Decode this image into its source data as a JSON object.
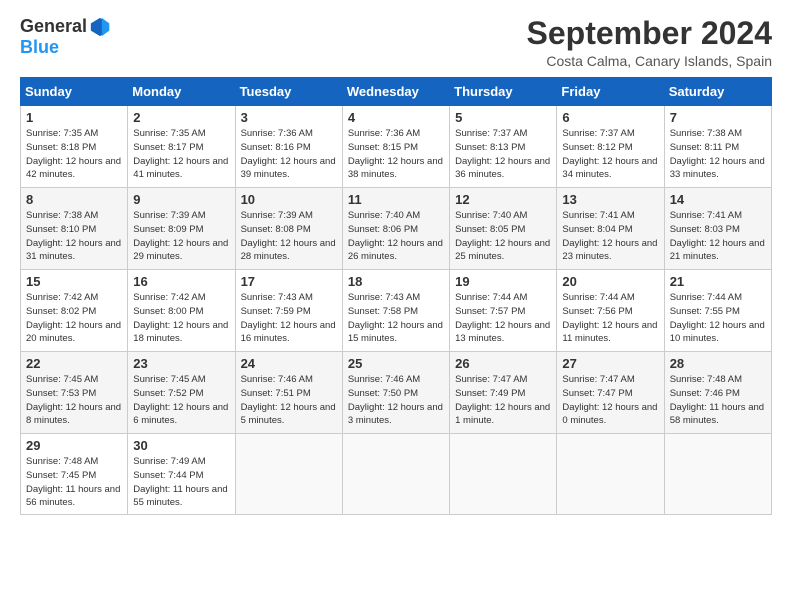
{
  "logo": {
    "line1": "General",
    "line2": "Blue"
  },
  "title": "September 2024",
  "location": "Costa Calma, Canary Islands, Spain",
  "headers": [
    "Sunday",
    "Monday",
    "Tuesday",
    "Wednesday",
    "Thursday",
    "Friday",
    "Saturday"
  ],
  "weeks": [
    [
      {
        "day": "1",
        "sunrise": "7:35 AM",
        "sunset": "8:18 PM",
        "daylight": "12 hours and 42 minutes."
      },
      {
        "day": "2",
        "sunrise": "7:35 AM",
        "sunset": "8:17 PM",
        "daylight": "12 hours and 41 minutes."
      },
      {
        "day": "3",
        "sunrise": "7:36 AM",
        "sunset": "8:16 PM",
        "daylight": "12 hours and 39 minutes."
      },
      {
        "day": "4",
        "sunrise": "7:36 AM",
        "sunset": "8:15 PM",
        "daylight": "12 hours and 38 minutes."
      },
      {
        "day": "5",
        "sunrise": "7:37 AM",
        "sunset": "8:13 PM",
        "daylight": "12 hours and 36 minutes."
      },
      {
        "day": "6",
        "sunrise": "7:37 AM",
        "sunset": "8:12 PM",
        "daylight": "12 hours and 34 minutes."
      },
      {
        "day": "7",
        "sunrise": "7:38 AM",
        "sunset": "8:11 PM",
        "daylight": "12 hours and 33 minutes."
      }
    ],
    [
      {
        "day": "8",
        "sunrise": "7:38 AM",
        "sunset": "8:10 PM",
        "daylight": "12 hours and 31 minutes."
      },
      {
        "day": "9",
        "sunrise": "7:39 AM",
        "sunset": "8:09 PM",
        "daylight": "12 hours and 29 minutes."
      },
      {
        "day": "10",
        "sunrise": "7:39 AM",
        "sunset": "8:08 PM",
        "daylight": "12 hours and 28 minutes."
      },
      {
        "day": "11",
        "sunrise": "7:40 AM",
        "sunset": "8:06 PM",
        "daylight": "12 hours and 26 minutes."
      },
      {
        "day": "12",
        "sunrise": "7:40 AM",
        "sunset": "8:05 PM",
        "daylight": "12 hours and 25 minutes."
      },
      {
        "day": "13",
        "sunrise": "7:41 AM",
        "sunset": "8:04 PM",
        "daylight": "12 hours and 23 minutes."
      },
      {
        "day": "14",
        "sunrise": "7:41 AM",
        "sunset": "8:03 PM",
        "daylight": "12 hours and 21 minutes."
      }
    ],
    [
      {
        "day": "15",
        "sunrise": "7:42 AM",
        "sunset": "8:02 PM",
        "daylight": "12 hours and 20 minutes."
      },
      {
        "day": "16",
        "sunrise": "7:42 AM",
        "sunset": "8:00 PM",
        "daylight": "12 hours and 18 minutes."
      },
      {
        "day": "17",
        "sunrise": "7:43 AM",
        "sunset": "7:59 PM",
        "daylight": "12 hours and 16 minutes."
      },
      {
        "day": "18",
        "sunrise": "7:43 AM",
        "sunset": "7:58 PM",
        "daylight": "12 hours and 15 minutes."
      },
      {
        "day": "19",
        "sunrise": "7:44 AM",
        "sunset": "7:57 PM",
        "daylight": "12 hours and 13 minutes."
      },
      {
        "day": "20",
        "sunrise": "7:44 AM",
        "sunset": "7:56 PM",
        "daylight": "12 hours and 11 minutes."
      },
      {
        "day": "21",
        "sunrise": "7:44 AM",
        "sunset": "7:55 PM",
        "daylight": "12 hours and 10 minutes."
      }
    ],
    [
      {
        "day": "22",
        "sunrise": "7:45 AM",
        "sunset": "7:53 PM",
        "daylight": "12 hours and 8 minutes."
      },
      {
        "day": "23",
        "sunrise": "7:45 AM",
        "sunset": "7:52 PM",
        "daylight": "12 hours and 6 minutes."
      },
      {
        "day": "24",
        "sunrise": "7:46 AM",
        "sunset": "7:51 PM",
        "daylight": "12 hours and 5 minutes."
      },
      {
        "day": "25",
        "sunrise": "7:46 AM",
        "sunset": "7:50 PM",
        "daylight": "12 hours and 3 minutes."
      },
      {
        "day": "26",
        "sunrise": "7:47 AM",
        "sunset": "7:49 PM",
        "daylight": "12 hours and 1 minute."
      },
      {
        "day": "27",
        "sunrise": "7:47 AM",
        "sunset": "7:47 PM",
        "daylight": "12 hours and 0 minutes."
      },
      {
        "day": "28",
        "sunrise": "7:48 AM",
        "sunset": "7:46 PM",
        "daylight": "11 hours and 58 minutes."
      }
    ],
    [
      {
        "day": "29",
        "sunrise": "7:48 AM",
        "sunset": "7:45 PM",
        "daylight": "11 hours and 56 minutes."
      },
      {
        "day": "30",
        "sunrise": "7:49 AM",
        "sunset": "7:44 PM",
        "daylight": "11 hours and 55 minutes."
      },
      null,
      null,
      null,
      null,
      null
    ]
  ]
}
